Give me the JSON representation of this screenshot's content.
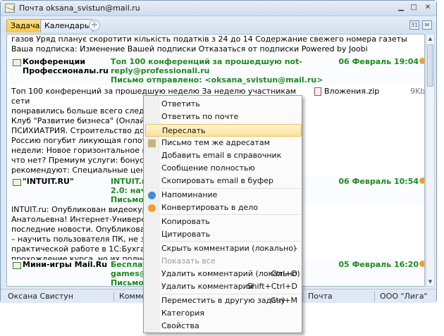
{
  "window": {
    "title": "Почта oksana_svistun@mail.ru"
  },
  "tabs": [
    {
      "label": "Задача"
    },
    {
      "label": "Календарь"
    }
  ],
  "messages": {
    "top_text": "газов Уряд планує скоротити кількість податків з 24 до 14 Содержание свежего номера газеты Ваша подписка: Изменение Вашей подписки Отказаться от подписки Powered by Joobi",
    "m1": {
      "from": "Конференции\nПрофессионалы.ru",
      "subject": "Топ 100 конференций за прошедшую not-\nreply@professionali.ru\nПисьмо отправлено: <oksana_svistun@mail.ru>",
      "date": "06 Февраль 19:04",
      "attachment_name": "Вложения.zip",
      "attachment_size": "9Kb",
      "body": "Топ 100 конференций за прошедшую неделю За неделю участникам сети\nпонравились больше всего следу\nКлуб \"Развитие бизнеса\" (Онлайн                                ДИКА. НЕЗАБВЕННАЯ\nПСИХИАТРИЯ. Строительство дома                              ... нежно! Михаил Делягин.\nРоссию погубит ликующая гопота                              ошедшую неделю Тема\nнедели: Новое горизонтальное ме                              ваше мнение, что нравится, а\nчто нет? Премиум услуги: бонус 2                              аунта ПРО » Профессионалы\nрекомендуют: Специальные цены                             оступлении. Подробнее.. Не\nхотите получать оповещения о но                            повещения в личных\nнастройках.© 2012, Профессионал"
    },
    "m2": {
      "from": "\"INTUIT.RU\"",
      "subject": "INTUIT.ru:\n2.0: начал\nПисьмо от",
      "date": "06 Февраль 10:54",
      "body": "INTUIT.ru: Опубликован видеокур                               важаемая Оксана\nАнатольевна! Интернет-Универси                               ает Вам как подписчику\nпоследние новости. Опубликован                               работы\" Главная задача курса\n– научить пользователя ПК, не зн                               ем от компании 1С,\nпрактической работе в 1С:Бухгал                               ю программ от 1С ускорят\nпрохождение курса, но их полное"
    },
    "m3": {
      "from": "Мини-игры Mail.Ru",
      "subject": "Бесплатн\ngames@co\nПисьмо от",
      "date": "05 Февраль 16:20"
    }
  },
  "context_menu": {
    "items": [
      {
        "label": "Ответить",
        "shortcut": ""
      },
      {
        "label": "Ответить по почте",
        "shortcut": ""
      },
      {
        "label": "Переслать",
        "shortcut": ""
      },
      {
        "label": "Письмо тем же адресатам",
        "shortcut": ""
      },
      {
        "label": "Добавить email в справочник",
        "shortcut": ""
      },
      {
        "label": "Сообщение полностью",
        "shortcut": ""
      },
      {
        "label": "Скопировать email в буфер",
        "shortcut": ""
      },
      {
        "label": "Напоминание",
        "shortcut": ""
      },
      {
        "label": "Конвертировать в дело",
        "shortcut": ""
      },
      {
        "label": "Копировать",
        "shortcut": ""
      },
      {
        "label": "Цитировать",
        "shortcut": ""
      },
      {
        "label": "Скрыть комментарии (локально)",
        "shortcut": "-"
      },
      {
        "label": "Показать все",
        "shortcut": ""
      },
      {
        "label": "Удалить комментарий (локально)",
        "shortcut": "Ctrl+D"
      },
      {
        "label": "Удалить комментарий",
        "shortcut": "Shift+Ctrl+D"
      },
      {
        "label": "Переместить в другую задачу",
        "shortcut": "Ctrl+M"
      },
      {
        "label": "Категория",
        "shortcut": ""
      },
      {
        "label": "Свойства",
        "shortcut": ""
      }
    ]
  },
  "statusbar": {
    "user": "Оксана Свистун",
    "comments": "Коммен",
    "mail": "Почта",
    "org": "ООО \"Лига\""
  }
}
